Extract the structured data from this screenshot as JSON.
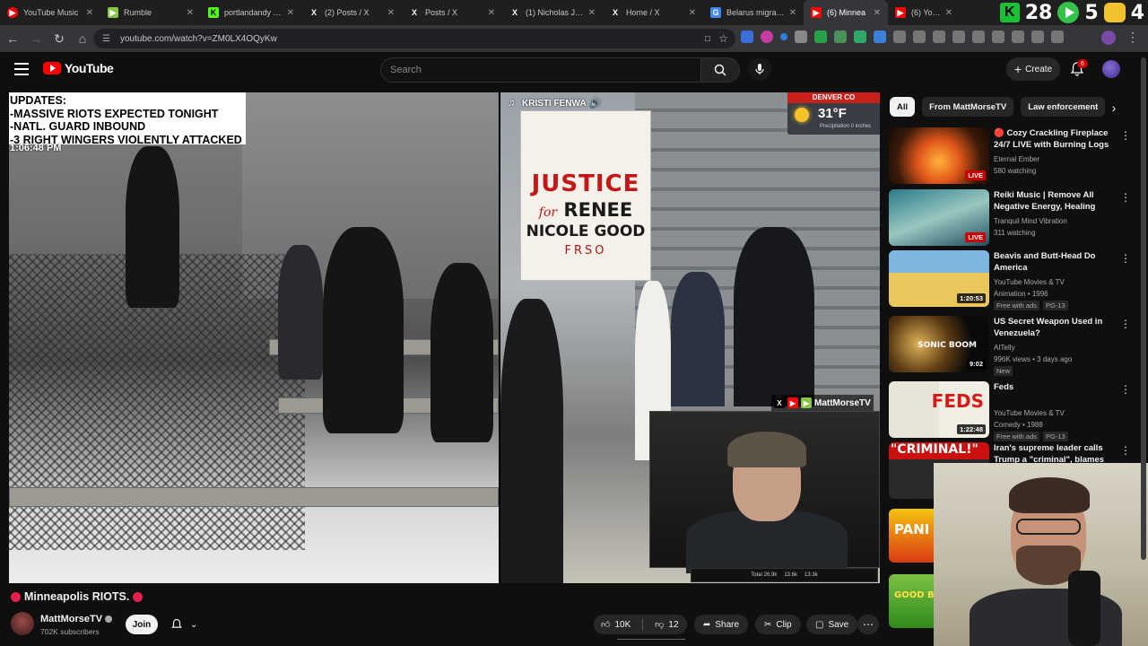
{
  "browser": {
    "tabs": [
      {
        "label": "YouTube Music",
        "icon": "youtube-music-icon",
        "color": "#ff0000"
      },
      {
        "label": "Rumble",
        "icon": "rumble-icon",
        "color": "#85c742"
      },
      {
        "label": "portlandandy Stre",
        "icon": "kick-icon",
        "color": "#53fc18"
      },
      {
        "label": "(2) Posts / X",
        "icon": "x-icon",
        "color": "#ffffff"
      },
      {
        "label": "Posts / X",
        "icon": "x-icon",
        "color": "#ffffff"
      },
      {
        "label": "(1) Nicholas J. Fue",
        "icon": "x-icon",
        "color": "#ffffff"
      },
      {
        "label": "Home / X",
        "icon": "x-icon",
        "color": "#ffffff"
      },
      {
        "label": "Belarus migrant -",
        "icon": "google-icon",
        "color": "#4285f4"
      },
      {
        "label": "(6) Minnea",
        "icon": "youtube-icon",
        "color": "#ff0000",
        "active": true
      },
      {
        "label": "(6) YouTube",
        "icon": "youtube-icon",
        "color": "#ff0000"
      }
    ],
    "counters": {
      "a": "28",
      "b": "5",
      "c": "4"
    },
    "url": "youtube.com/watch?v=ZM0LX4OQyKw"
  },
  "header": {
    "logo_text": "YouTube",
    "search_placeholder": "Search",
    "create_label": "Create",
    "notification_count": "6"
  },
  "video": {
    "overlay_updates": [
      "UPDATES:",
      "-MASSIVE RIOTS EXPECTED TONIGHT",
      "-NATL. GUARD INBOUND",
      "-3 RIGHT WINGERS VIOLENTLY ATTACKED"
    ],
    "overlay_timestamp": "1:06:48 PM",
    "tiktok_handle": "KRISTI FENWA",
    "sign": {
      "line1": "JUSTICE",
      "for": "for",
      "line2": "RENEE",
      "line3": "NICOLE GOOD",
      "line4": "FRSO"
    },
    "weather": {
      "city": "DENVER CO",
      "temp": "31°F",
      "precip": "Precipitation 0 inches"
    },
    "cam_label": "MattMorseTV",
    "stream_stats": [
      "Total 26.9k",
      "13.6k",
      "13.3k"
    ]
  },
  "meta": {
    "title": "Minneapolis RIOTS.",
    "channel_name": "MattMorseTV",
    "subscribers": "702K subscribers",
    "join_label": "Join",
    "likes": "10K",
    "dislikes": "12",
    "share_label": "Share",
    "clip_label": "Clip",
    "save_label": "Save"
  },
  "sidebar": {
    "chips": [
      "All",
      "From MattMorseTV",
      "Law enforcement"
    ],
    "recommendations": [
      {
        "title": "🔴 Cozy Crackling Fireplace 24/7 LIVE with Burning Logs ...",
        "channel": "Eternal Ember",
        "meta": "580 watching",
        "badge": "LIVE",
        "thumb": "fireplace"
      },
      {
        "title": "Reiki Music | Remove All Negative Energy, Healing Aura ...",
        "channel": "Tranquil Mind Vibration",
        "meta": "311 watching",
        "badge": "LIVE",
        "thumb": "reiki"
      },
      {
        "title": "Beavis and Butt-Head Do America",
        "channel": "YouTube Movies & TV",
        "meta": "Animation • 1996",
        "duration": "1:20:53",
        "tags": [
          "Free with ads",
          "PG-13"
        ],
        "thumb": "beavis"
      },
      {
        "title": "US Secret Weapon Used in Venezuela?",
        "channel": "AITelly",
        "meta": "996K views • 3 days ago",
        "duration": "9:02",
        "tags": [
          "New"
        ],
        "thumb": "sonic"
      },
      {
        "title": "Feds",
        "channel": "YouTube Movies & TV",
        "meta": "Comedy • 1988",
        "duration": "1:22:48",
        "tags": [
          "Free with ads",
          "PG-13"
        ],
        "thumb": "feds"
      },
      {
        "title": "Iran's supreme leader calls Trump a \"criminal\", blames hi...",
        "channel": "",
        "meta": "",
        "thumb": "criminal"
      }
    ],
    "thumb_texts": {
      "sonic": "SONIC BOOM",
      "feds": "FEDS",
      "criminal": "\"CRIMINAL!\"",
      "panic": "PANI MODE",
      "good": "GOOD Burger"
    }
  }
}
